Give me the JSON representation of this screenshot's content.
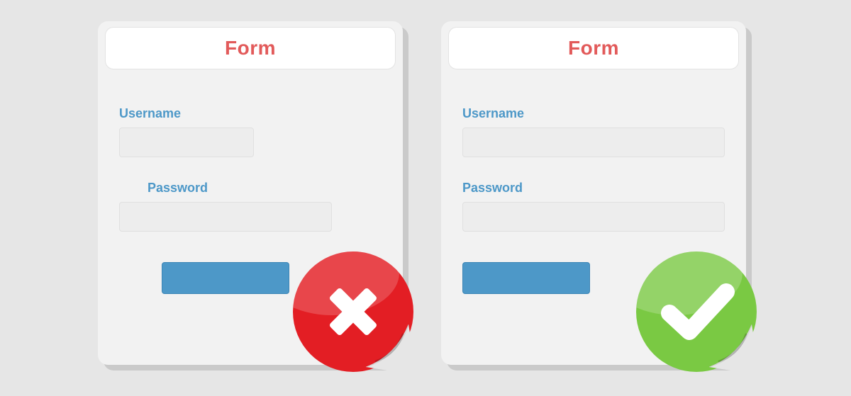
{
  "forms": {
    "left": {
      "title": "Form",
      "username_label": "Username",
      "password_label": "Password",
      "status": "incorrect"
    },
    "right": {
      "title": "Form",
      "username_label": "Username",
      "password_label": "Password",
      "status": "correct"
    }
  },
  "colors": {
    "accent_red": "#e25a5a",
    "accent_blue": "#4d98c8",
    "sticker_red": "#e31e24",
    "sticker_green": "#7ac943"
  }
}
